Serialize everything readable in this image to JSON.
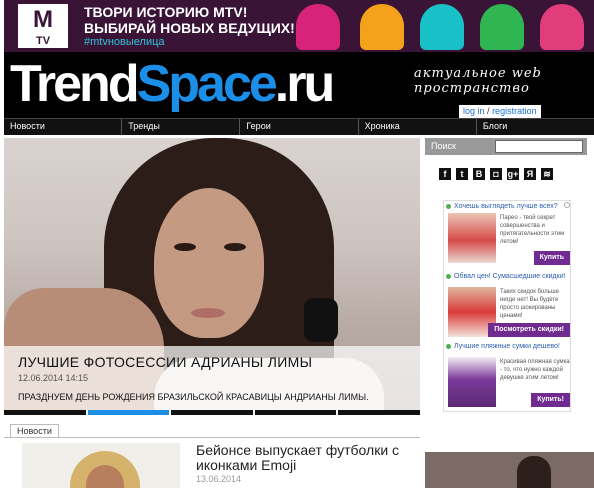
{
  "banner": {
    "logo_text": "M",
    "logo_sub": "TV",
    "line1": "ТВОРИ ИСТОРИЮ MTV!",
    "line2": "ВЫБИРАЙ НОВЫХ ВЕДУЩИХ!",
    "hashtag": "#mtvновыелица",
    "face_colors": [
      "#d7247a",
      "#f4a21c",
      "#18c0c8",
      "#2fb552",
      "#e13d7c"
    ]
  },
  "header": {
    "logo_part1": "Trend",
    "logo_part2": "Space",
    "logo_part3": ".ru",
    "tagline": "актуальное web пространство",
    "login": "log in",
    "separator": "/",
    "register": "registration"
  },
  "nav": {
    "items": [
      "Новости",
      "Тренды",
      "Герои",
      "Хроника",
      "Блоги"
    ]
  },
  "hero": {
    "title": "ЛУЧШИЕ ФОТОСЕССИИ АДРИАНЫ ЛИМЫ",
    "date": "12.06.2014 14:15",
    "description": "ПРАЗДНУЕМ ДЕНЬ РОЖДЕНИЯ БРАЗИЛЬСКОЙ КРАСАВИЦЫ АНДРИАНЫ ЛИМЫ.",
    "slides": 5,
    "active_slide": 2
  },
  "news": {
    "tab": "Новости",
    "title": "Бейонсе выпускает футболки с иконками Emoji",
    "date": "13.06.2014"
  },
  "sidebar": {
    "search_label": "Поиск",
    "search_value": "",
    "social": [
      {
        "icon": "facebook-icon",
        "glyph": "f"
      },
      {
        "icon": "twitter-icon",
        "glyph": "t"
      },
      {
        "icon": "vk-icon",
        "glyph": "В"
      },
      {
        "icon": "instagram-icon",
        "glyph": "◘"
      },
      {
        "icon": "google-plus-icon",
        "glyph": "g+"
      },
      {
        "icon": "yandex-icon",
        "glyph": "Я"
      },
      {
        "icon": "rss-icon",
        "glyph": "≋"
      }
    ],
    "ads": [
      {
        "title": "Хочешь выглядеть лучше всех?",
        "text": "Парео - твой секрет совершенства и притягательности этим летом!",
        "button": "Купить",
        "color": "#d64a4a"
      },
      {
        "title": "Обвал цен! Сумасшедшие скидки!",
        "text": "Таких скидок больше нигде нет! Вы будете просто шокированы ценами!",
        "button": "Посмотреть скидки!",
        "color": "#d93b3b"
      },
      {
        "title": "Лучшие пляжные сумки дешево!",
        "text": "Красивая пляжная сумка - то, что нужно каждой девушке этим летом!",
        "button": "Купить!",
        "color": "#7b3a9a"
      }
    ]
  }
}
